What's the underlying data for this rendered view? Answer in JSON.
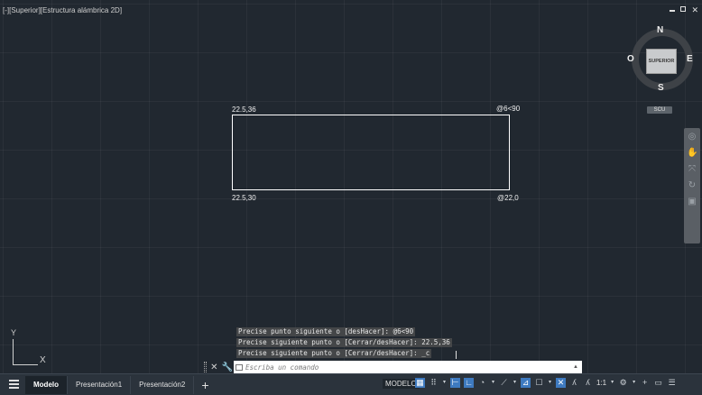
{
  "viewport": {
    "label": "[-][Superior][Estructura alámbrica 2D]"
  },
  "window_controls": {
    "minimize": "_",
    "maximize": "□",
    "close": "✕"
  },
  "drawing": {
    "coords": {
      "top_left": "22.5,36",
      "top_right": "@6<90",
      "bottom_left": "22.5,30",
      "bottom_right": "@22,0"
    }
  },
  "viewcube": {
    "face": "SUPERIOR",
    "north": "N",
    "south": "S",
    "east": "E",
    "west": "O",
    "ucs_menu": "SCU"
  },
  "ucs_icon": {
    "y": "Y",
    "x": "X"
  },
  "command_history": [
    "Precise punto siguiente o [desHacer]: @6<90",
    "Precise siguiente punto o [Cerrar/desHacer]: 22.5,36",
    "Precise siguiente punto o [Cerrar/desHacer]: _c"
  ],
  "command_line": {
    "placeholder": "Escriba un comando",
    "close_icon": "✕",
    "customize_icon": "wrench-icon",
    "history_arrow": "▲"
  },
  "status_bar": {
    "tabs": [
      "Modelo",
      "Presentación1",
      "Presentación2"
    ],
    "add_tab": "+",
    "model_button": "MODELO",
    "scale": "1:1",
    "tool_icons": [
      "grid-icon",
      "snap-icon",
      "infer-icon",
      "ortho-icon",
      "polar-icon",
      "isodraft-icon",
      "osnap-icon",
      "linewidth-icon",
      "transparency-icon",
      "annotation-visibility-icon",
      "auto-scale-icon",
      "annotation-scale-icon",
      "workspace-gear-icon",
      "add-icon",
      "units-icon",
      "customize-menu-icon"
    ]
  },
  "colors": {
    "background": "#212830",
    "status_bar": "#2b333c",
    "active_tool": "#3e7ac0",
    "geometry": "#ffffff"
  }
}
